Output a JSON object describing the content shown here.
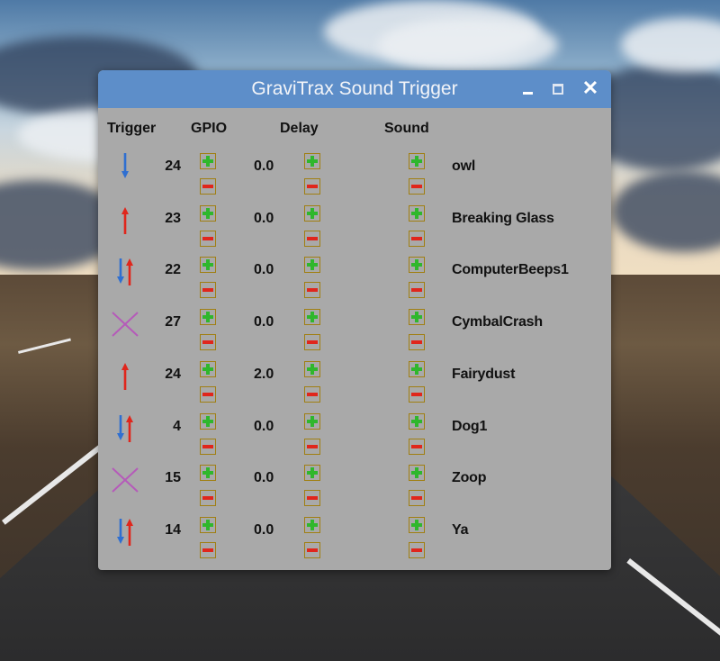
{
  "window": {
    "title": "GraviTrax Sound Trigger",
    "controls": {
      "minimize_icon": "minimize-icon",
      "maximize_icon": "maximize-icon",
      "close_glyph": "✕"
    }
  },
  "headers": {
    "trigger": "Trigger",
    "gpio": "GPIO",
    "delay": "Delay",
    "sound": "Sound"
  },
  "colors": {
    "titlebar": "#5d8ec9",
    "window_bg": "#a9a9a9",
    "arrow_down": "#2f6fd1",
    "arrow_up": "#e0261c",
    "cross": "#b55ab9",
    "plus": "#2fb72c",
    "minus": "#e0261c",
    "button_border": "#a07f12"
  },
  "rows": [
    {
      "trigger": "falling",
      "trigger_icon": "arrow-down-icon",
      "gpio": "24",
      "delay": "0.0",
      "sound": "owl"
    },
    {
      "trigger": "rising",
      "trigger_icon": "arrow-up-icon",
      "gpio": "23",
      "delay": "0.0",
      "sound": "Breaking Glass"
    },
    {
      "trigger": "both",
      "trigger_icon": "arrow-up-down-icon",
      "gpio": "22",
      "delay": "0.0",
      "sound": "ComputerBeeps1"
    },
    {
      "trigger": "off",
      "trigger_icon": "cross-icon",
      "gpio": "27",
      "delay": "0.0",
      "sound": "CymbalCrash"
    },
    {
      "trigger": "rising",
      "trigger_icon": "arrow-up-icon",
      "gpio": "24",
      "delay": "2.0",
      "sound": "Fairydust"
    },
    {
      "trigger": "both",
      "trigger_icon": "arrow-up-down-icon",
      "gpio": "4",
      "delay": "0.0",
      "sound": "Dog1"
    },
    {
      "trigger": "off",
      "trigger_icon": "cross-icon",
      "gpio": "15",
      "delay": "0.0",
      "sound": "Zoop"
    },
    {
      "trigger": "both",
      "trigger_icon": "arrow-up-down-icon",
      "gpio": "14",
      "delay": "0.0",
      "sound": "Ya"
    }
  ]
}
